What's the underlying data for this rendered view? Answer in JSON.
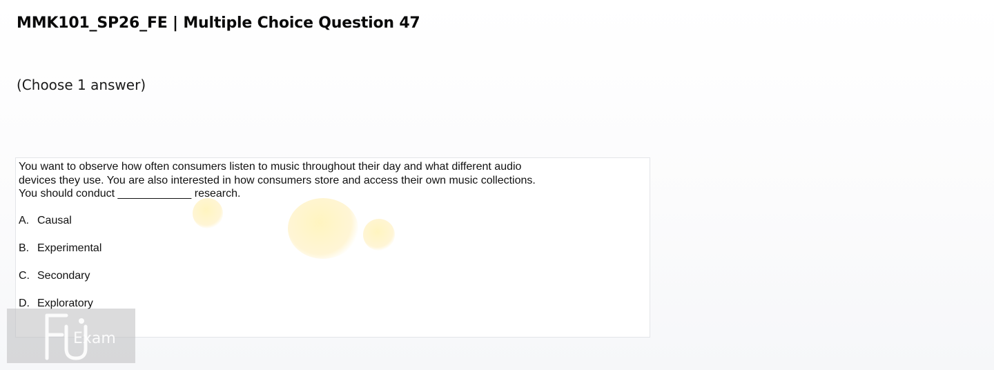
{
  "header": {
    "title": "MMK101_SP26_FE | Multiple Choice Question 47",
    "instruction": "(Choose 1 answer)"
  },
  "question": {
    "lines": [
      "You want to observe how often consumers listen to music throughout their day and what different audio",
      "devices they use. You are also interested in how consumers store and access their own music collections.",
      "You should conduct ____________ research."
    ],
    "options": [
      {
        "letter": "A.",
        "text": "Causal"
      },
      {
        "letter": "B.",
        "text": "Experimental"
      },
      {
        "letter": "C.",
        "text": "Secondary"
      },
      {
        "letter": "D.",
        "text": "Exploratory"
      }
    ]
  },
  "watermark": {
    "brand_text": "Exam",
    "monogram": "FU"
  }
}
